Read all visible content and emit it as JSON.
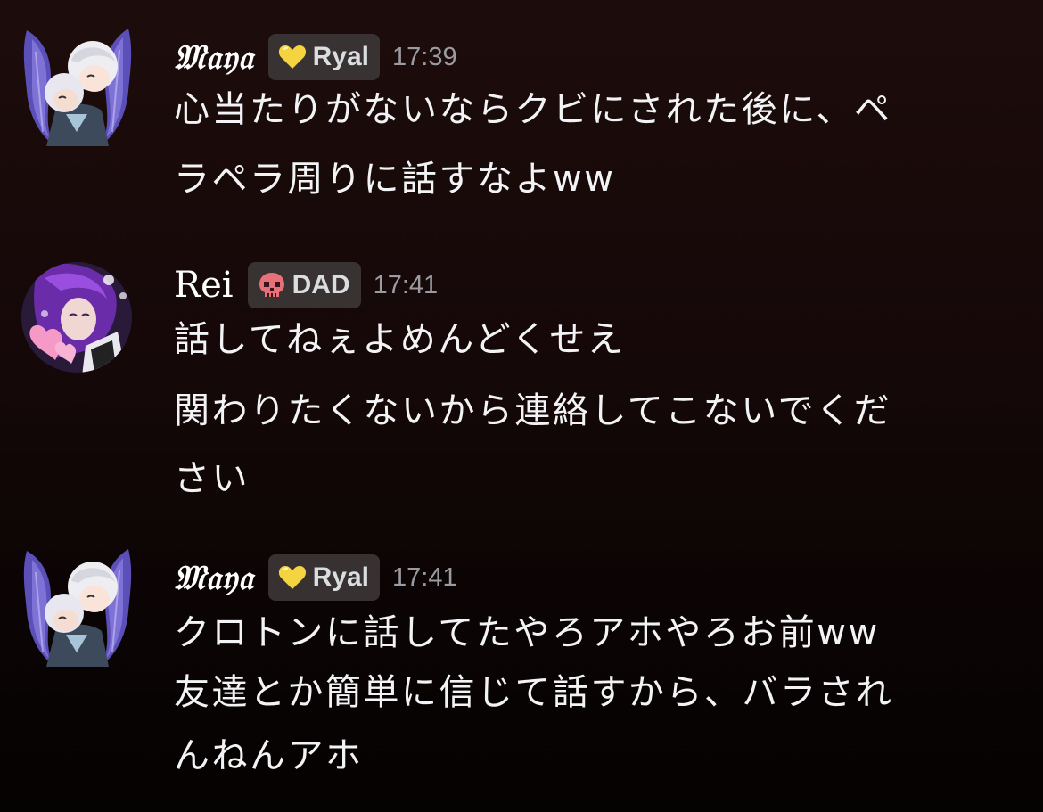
{
  "messages": [
    {
      "username": "𝔐𝔞𝔶𝔞",
      "tag_label": "Ryal",
      "tag_icon": "yellow-heart-icon",
      "timestamp": "17:39",
      "lines": [
        "心当たりがないならクビにされた後に、ペ",
        "ラペラ周りに話すなよww"
      ]
    },
    {
      "username": "Rei",
      "tag_label": "DAD",
      "tag_icon": "skull-icon",
      "timestamp": "17:41",
      "lines": [
        "話してねぇよめんどくせえ",
        "関わりたくないから連絡してこないでくだ",
        "さい"
      ]
    },
    {
      "username": "𝔐𝔞𝔶𝔞",
      "tag_label": "Ryal",
      "tag_icon": "yellow-heart-icon",
      "timestamp": "17:41",
      "lines": [
        "クロトンに話してたやろアホやろお前ww",
        "友達とか簡単に信じて話すから、バラされ",
        "んねんアホ"
      ]
    }
  ],
  "colors": {
    "background_top": "#1d0c0c",
    "background_bottom": "#050202",
    "text": "#f2f3f5",
    "timestamp": "#9a9ca2",
    "tag_background": "#3e3838",
    "ryal_heart": "#f5d442",
    "dad_skull": "#e8707a"
  }
}
